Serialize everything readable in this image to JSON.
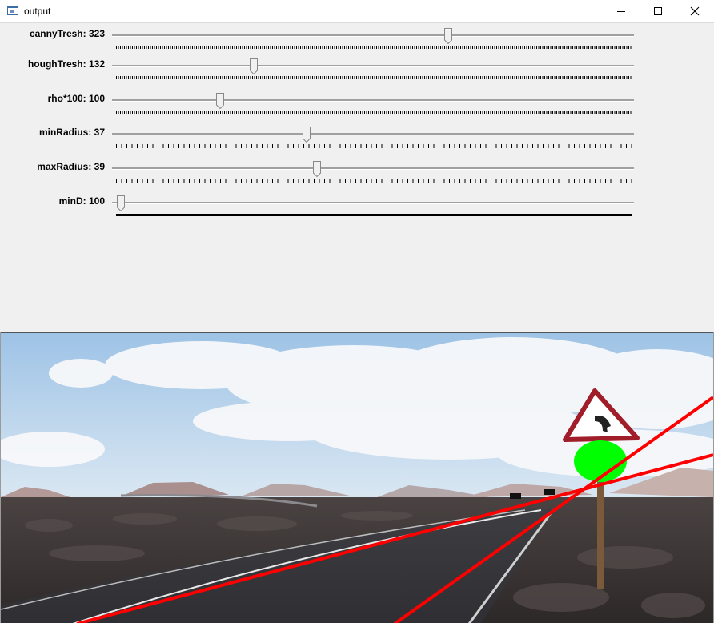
{
  "window": {
    "title": "output",
    "icon": "app-window-icon",
    "controls": [
      "minimize-icon",
      "maximize-icon",
      "close-icon"
    ]
  },
  "trackbars": [
    {
      "label": "cannyTresh: 323",
      "position": 0.64
    },
    {
      "label": "houghTresh: 132",
      "position": 0.27
    },
    {
      "label": "rho*100: 100",
      "position": 0.205
    },
    {
      "label": "minRadius: 37",
      "position": 0.375
    },
    {
      "label": "maxRadius: 39",
      "position": 0.395
    },
    {
      "label": "minD: 100",
      "position": 0.01
    }
  ],
  "image": {
    "scene": "road-with-warning-sign",
    "colors": {
      "sky": "#b8d3ea",
      "detected_line": "#ff0000",
      "detected_circle": "#00ff00",
      "sign_border": "#a01e2a"
    }
  }
}
